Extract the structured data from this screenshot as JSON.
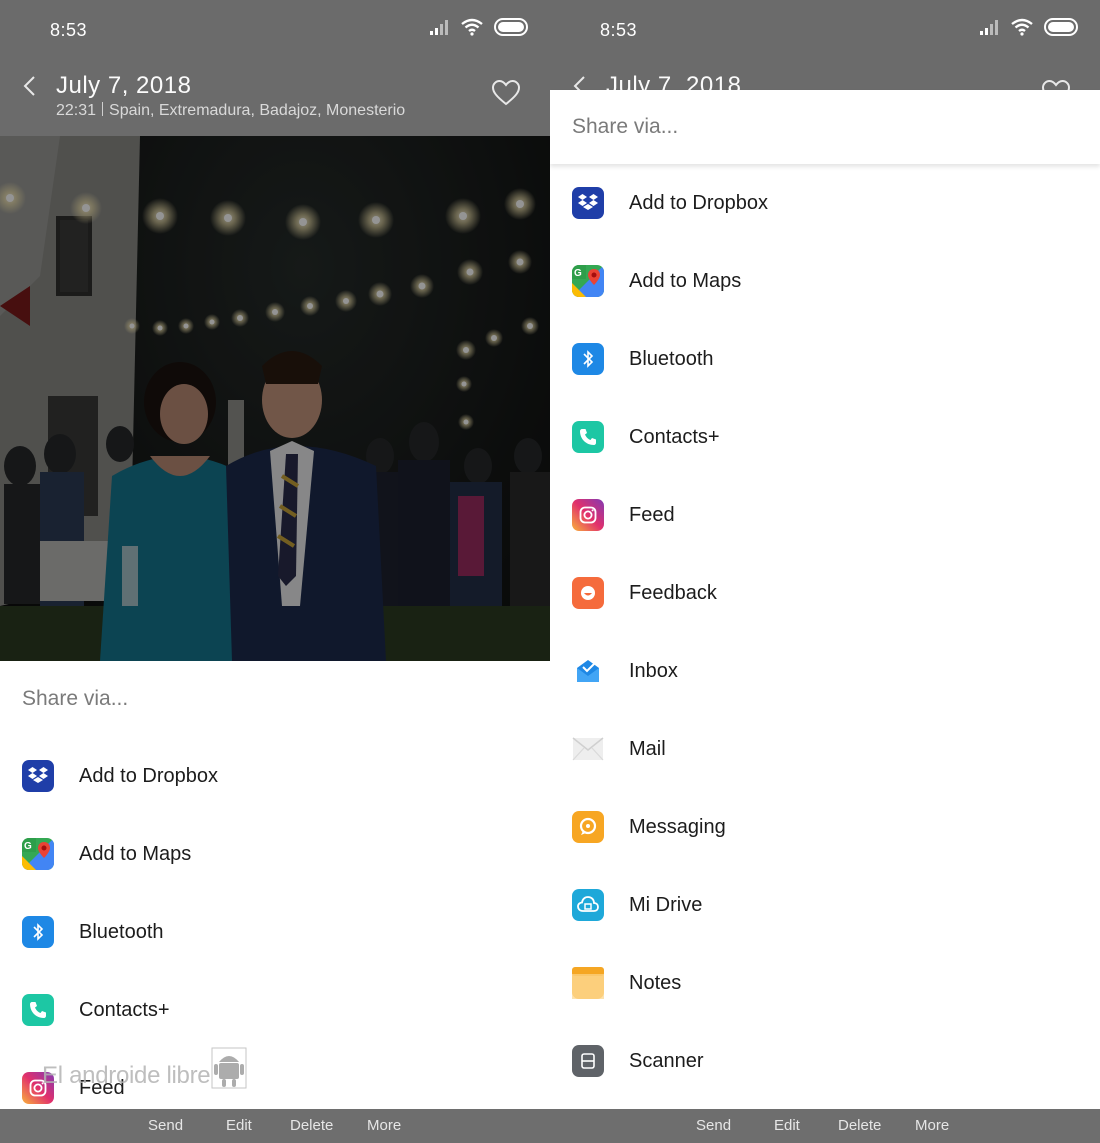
{
  "status": {
    "time": "8:53"
  },
  "header": {
    "title": "July  7,  2018",
    "time": "22:31",
    "location": "Spain, Extremadura, Badajoz, Monesterio",
    "partial_title": "July  7,  2018"
  },
  "sheet": {
    "title": "Share via..."
  },
  "left_items": [
    {
      "label": "Add to Dropbox",
      "icon": "dropbox-icon"
    },
    {
      "label": "Add to Maps",
      "icon": "maps-icon"
    },
    {
      "label": "Bluetooth",
      "icon": "bluetooth-icon"
    },
    {
      "label": "Contacts+",
      "icon": "phone-icon"
    },
    {
      "label": "Feed",
      "icon": "instagram-icon"
    }
  ],
  "right_items": [
    {
      "label": "Add to Dropbox",
      "icon": "dropbox-icon"
    },
    {
      "label": "Add to Maps",
      "icon": "maps-icon"
    },
    {
      "label": "Bluetooth",
      "icon": "bluetooth-icon"
    },
    {
      "label": "Contacts+",
      "icon": "phone-icon"
    },
    {
      "label": "Feed",
      "icon": "instagram-icon"
    },
    {
      "label": "Feedback",
      "icon": "feedback-icon"
    },
    {
      "label": "Inbox",
      "icon": "inbox-icon"
    },
    {
      "label": "Mail",
      "icon": "mail-icon"
    },
    {
      "label": "Messaging",
      "icon": "messaging-icon"
    },
    {
      "label": "Mi Drive",
      "icon": "cloud-icon"
    },
    {
      "label": "Notes",
      "icon": "notes-icon"
    },
    {
      "label": "Scanner",
      "icon": "scanner-icon"
    }
  ],
  "bottom_actions": {
    "send": "Send",
    "edit": "Edit",
    "delete": "Delete",
    "more": "More"
  },
  "watermark": "El androide libre",
  "colors": {
    "dim_bar": "#6b6b6b",
    "dropbox": "#1f3ea8",
    "bluetooth": "#1e88e5",
    "contacts": "#1dc7a4",
    "feedback": "#f56b3c",
    "messaging": "#f7a623",
    "mi_drive": "#1ea8d9",
    "notes": "#fbbf5a",
    "scanner": "#5f6368"
  }
}
